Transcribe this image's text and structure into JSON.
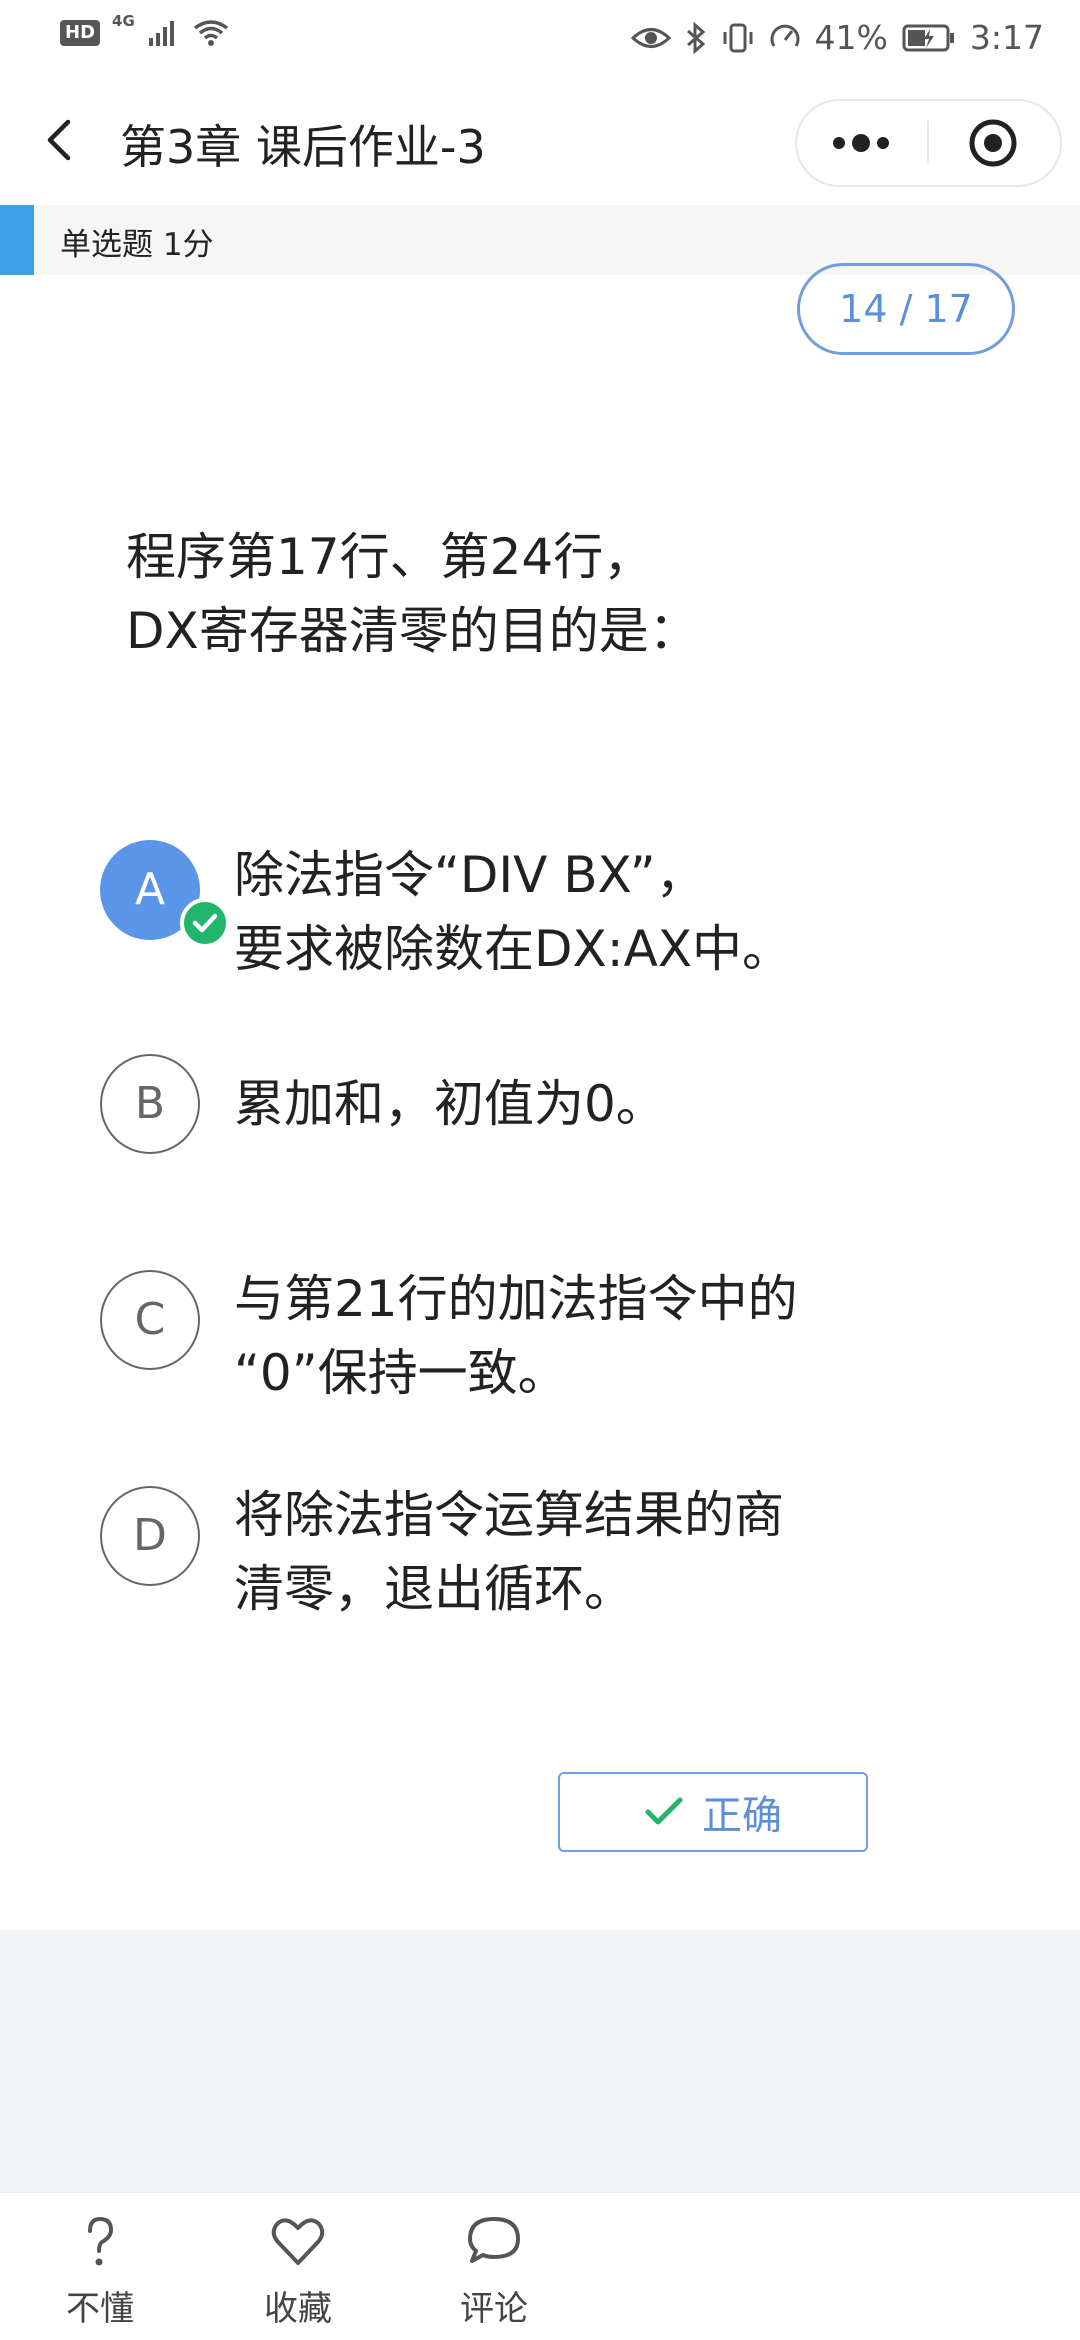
{
  "status_bar": {
    "hd": "HD",
    "network": "4G",
    "battery_percent": "41%",
    "time": "3:17"
  },
  "header": {
    "title": "第3章 课后作业-3",
    "more_icon": "more-dots-icon",
    "close_icon": "target-close-icon"
  },
  "question": {
    "type_label": "单选题 1分",
    "progress": "14 / 17",
    "text_lines": [
      "程序第17行、第24行，",
      "DX寄存器清零的目的是："
    ]
  },
  "options": [
    {
      "letter": "A",
      "lines": [
        "除法指令“DIV BX”，",
        "要求被除数在DX:AX中。"
      ],
      "selected": true
    },
    {
      "letter": "B",
      "lines": [
        "累加和，初值为0。"
      ],
      "selected": false
    },
    {
      "letter": "C",
      "lines": [
        "与第21行的加法指令中的",
        "“0”保持一致。"
      ],
      "selected": false
    },
    {
      "letter": "D",
      "lines": [
        "将除法指令运算结果的商",
        "清零，退出循环。"
      ],
      "selected": false
    }
  ],
  "result": {
    "label": "正确",
    "icon": "check-icon"
  },
  "toolbar": {
    "items": [
      {
        "label": "不懂",
        "icon": "question-mark-icon"
      },
      {
        "label": "收藏",
        "icon": "heart-icon"
      },
      {
        "label": "评论",
        "icon": "speech-bubble-icon"
      }
    ]
  },
  "colors": {
    "accent_blue": "#5b95e8",
    "type_accent": "#3aa1e6",
    "success_green": "#21b66b",
    "outline_blue": "#6f9de0"
  }
}
